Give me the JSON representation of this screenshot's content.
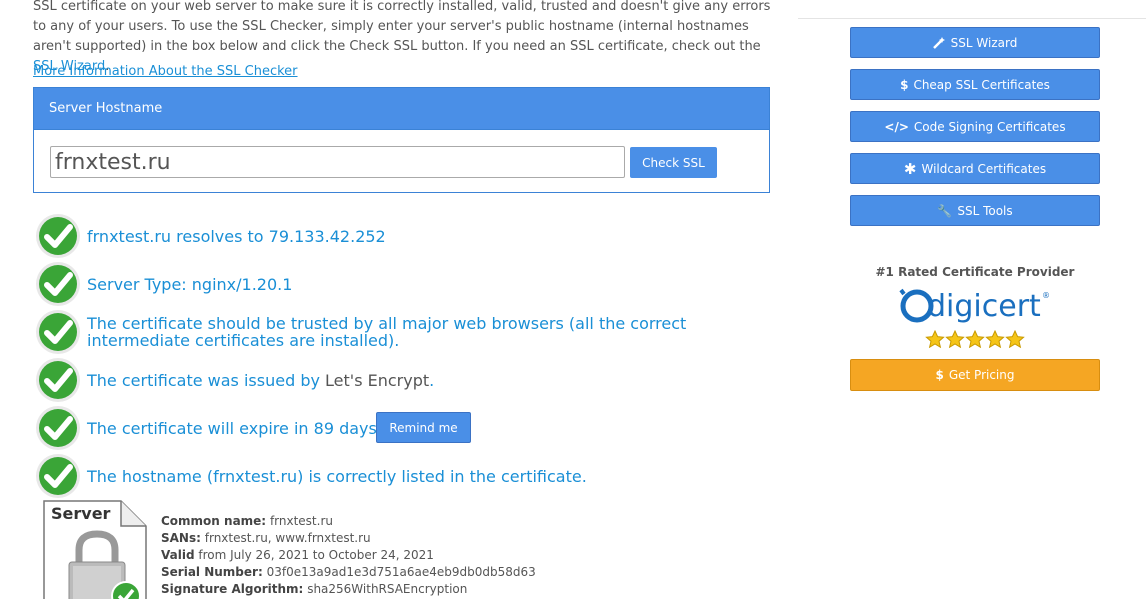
{
  "intro": {
    "text": "SSL certificate on your web server to make sure it is correctly installed, valid, trusted and doesn't give any errors to any of your users. To use the SSL Checker, simply enter your server's public hostname (internal hostnames aren't supported) in the box below and click the Check SSL button. If you need an SSL certificate, check out the",
    "link": "SSL Wizard",
    "end": "."
  },
  "more_info": "More Information About the SSL Checker",
  "form": {
    "header": "Server Hostname",
    "hostname_value": "frnxtest.ru",
    "check_button": "Check SSL"
  },
  "results": [
    {
      "text": "frnxtest.ru resolves to 79.133.42.252"
    },
    {
      "text": "Server Type: nginx/1.20.1"
    },
    {
      "text": "The certificate should be trusted by all major web browsers (all the correct intermediate certificates are installed)."
    },
    {
      "text": "The certificate was issued by",
      "issuer": "Let's Encrypt",
      "end": "."
    },
    {
      "text": "The certificate will expire in 89 days.",
      "button": "Remind me"
    },
    {
      "text": "The hostname (frnxtest.ru) is correctly listed in the certificate."
    }
  ],
  "server_badge": "Server",
  "details": {
    "common_name_label": "Common name:",
    "common_name": "frnxtest.ru",
    "sans_label": "SANs:",
    "sans": "frnxtest.ru, www.frnxtest.ru",
    "valid_label": "Valid",
    "valid": "from July 26, 2021 to October 24, 2021",
    "serial_label": "Serial Number:",
    "serial": "03f0e13a9ad1e3d751a6ae4eb9db0db58d63",
    "sig_label": "Signature Algorithm:",
    "sig": "sha256WithRSAEncryption"
  },
  "sidebar": {
    "buttons": [
      {
        "label": "SSL Wizard",
        "icon": "magic-wand-icon"
      },
      {
        "label": "Cheap SSL Certificates",
        "icon": "dollar-icon"
      },
      {
        "label": "Code Signing Certificates",
        "icon": "code-icon"
      },
      {
        "label": "Wildcard Certificates",
        "icon": "asterisk-icon"
      },
      {
        "label": "SSL Tools",
        "icon": "wrench-icon"
      }
    ],
    "rated": "#1 Rated Certificate Provider",
    "logo_text": "digicert",
    "rating_stars": 5,
    "pricing_button": "Get Pricing"
  },
  "colors": {
    "primary": "#4a8fe7",
    "link": "#1a8fd6",
    "pricing": "#f5a623",
    "check_green": "#3aa537"
  }
}
